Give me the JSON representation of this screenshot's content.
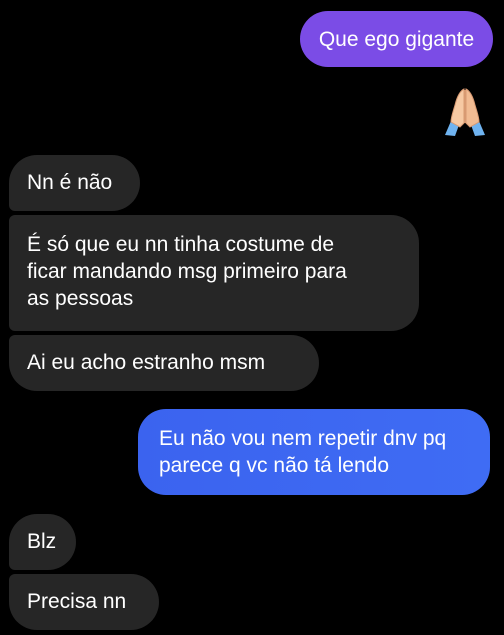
{
  "conversation": {
    "messages": [
      {
        "sender": "me",
        "text": "Que ego gigante",
        "color": "#7b4ce6"
      },
      {
        "sender": "me",
        "reaction": "🙏",
        "reaction_name": "folded-hands"
      },
      {
        "sender": "them",
        "text": "Nn é não"
      },
      {
        "sender": "them",
        "text": "É só que eu nn tinha costume de\nficar mandando msg primeiro para\nas pessoas"
      },
      {
        "sender": "them",
        "text": "Ai eu acho estranho msm"
      },
      {
        "sender": "me",
        "text": "Eu não vou nem repetir dnv pq\nparece q vc não tá lendo",
        "color": "#3b63ef"
      },
      {
        "sender": "them",
        "text": "Blz"
      },
      {
        "sender": "them",
        "text": "Precisa nn"
      }
    ]
  },
  "colors": {
    "background": "#000000",
    "incoming_bubble": "#262626",
    "outgoing_purple": "#7b4ce6",
    "outgoing_blue": "#3b63ef",
    "text": "#ffffff"
  }
}
